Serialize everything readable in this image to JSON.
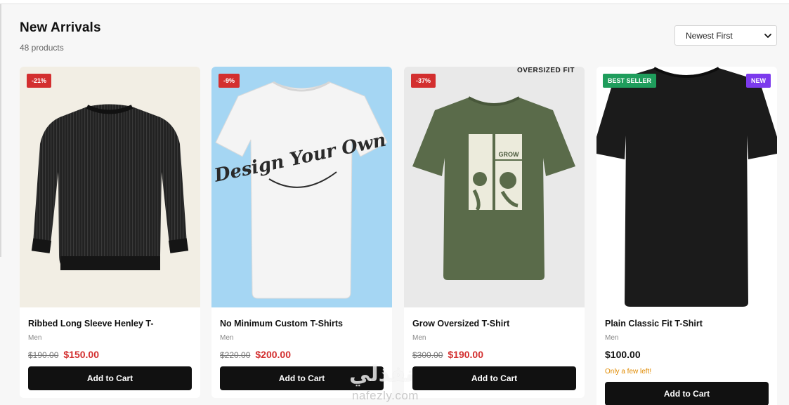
{
  "header": {
    "title": "New Arrivals",
    "count": "48 products"
  },
  "sort": {
    "selected": "Newest First"
  },
  "products": [
    {
      "name": "Ribbed Long Sleeve Henley T-",
      "category": "Men",
      "old_price": "$190.00",
      "price": "$150.00",
      "badge": "-21%",
      "button": "Add to Cart"
    },
    {
      "name": "No Minimum Custom T-Shirts",
      "category": "Men",
      "old_price": "$220.00",
      "price": "$200.00",
      "badge": "-9%",
      "button": "Add to Cart",
      "print_text": "Design Your Own"
    },
    {
      "name": "Grow Oversized T-Shirt",
      "category": "Men",
      "old_price": "$300.00",
      "price": "$190.00",
      "badge": "-37%",
      "button": "Add to Cart",
      "overlay": "OVERSIZED FIT",
      "print_text": "GROW"
    },
    {
      "name": "Plain Classic Fit T-Shirt",
      "category": "Men",
      "price": "$100.00",
      "stock": "Only a few left!",
      "badge_left": "BEST SELLER",
      "badge_right": "NEW",
      "button": "Add to Cart"
    }
  ],
  "watermark": {
    "script": "نفذلي",
    "url": "nafezly.com"
  },
  "colors": {
    "sale": "#d32f2f",
    "best_seller": "#1f9d5c",
    "new": "#7c3aed",
    "button": "#111111",
    "stock_warning": "#e08a00"
  }
}
